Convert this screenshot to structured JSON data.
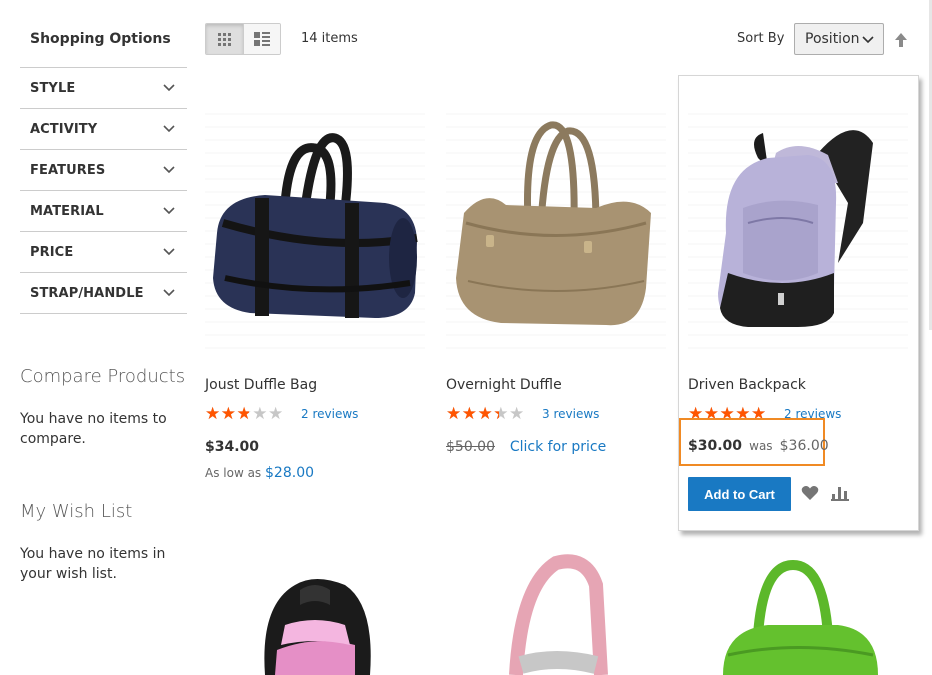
{
  "sidebar": {
    "title": "Shopping Options",
    "filters": [
      {
        "label": "STYLE"
      },
      {
        "label": "ACTIVITY"
      },
      {
        "label": "FEATURES"
      },
      {
        "label": "MATERIAL"
      },
      {
        "label": "PRICE"
      },
      {
        "label": "STRAP/HANDLE"
      }
    ],
    "compare": {
      "title": "Compare Products",
      "text": "You have no items to compare."
    },
    "wishlist": {
      "title": "My Wish List",
      "text": "You have no items in your wish list."
    }
  },
  "toolbar": {
    "item_count": "14 items",
    "sort_label": "Sort By",
    "sort_value": "Position",
    "view_mode": "grid"
  },
  "products": [
    {
      "name": "Joust Duffle Bag",
      "rating_fraction": 0.5,
      "reviews": "2 reviews",
      "price": "$34.00",
      "as_low_as_label": "As low as",
      "as_low_as_price": "$28.00"
    },
    {
      "name": "Overnight Duffle",
      "rating_fraction": 0.6,
      "reviews": "3 reviews",
      "old_price": "$50.00",
      "click_for_price": "Click for price"
    },
    {
      "name": "Driven Backpack",
      "rating_fraction": 0.9,
      "reviews": "2 reviews",
      "special_price": "$30.00",
      "was_label": "was",
      "regular_price": "$36.00",
      "add_to_cart": "Add to Cart"
    }
  ],
  "colors": {
    "accent": "#1979c3",
    "star": "#ff5501",
    "highlight": "#f08a24"
  },
  "icons": {
    "grid_view": "grid-icon",
    "list_view": "list-icon",
    "sort_direction": "arrow-up-icon",
    "wishlist": "heart-icon",
    "compare": "bar-chart-icon"
  }
}
